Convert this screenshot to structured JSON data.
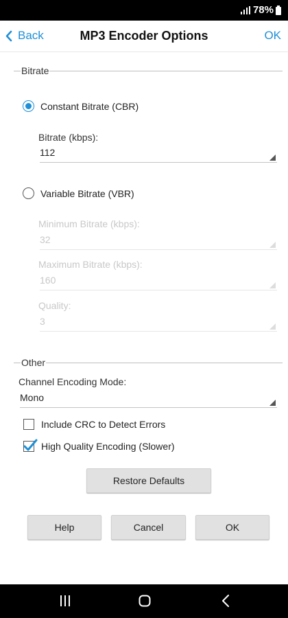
{
  "status_bar": {
    "battery": "78%"
  },
  "header": {
    "back_label": "Back",
    "title": "MP3 Encoder Options",
    "ok_label": "OK"
  },
  "bitrate_section": {
    "title": "Bitrate",
    "cbr_label": "Constant Bitrate (CBR)",
    "cbr_selected": true,
    "bitrate_label": "Bitrate (kbps):",
    "bitrate_value": "112",
    "vbr_label": "Variable Bitrate (VBR)",
    "vbr_selected": false,
    "min_label": "Minimum Bitrate (kbps):",
    "min_value": "32",
    "max_label": "Maximum Bitrate (kbps):",
    "max_value": "160",
    "quality_label": "Quality:",
    "quality_value": "3"
  },
  "other_section": {
    "title": "Other",
    "channel_label": "Channel Encoding Mode:",
    "channel_value": "Mono",
    "crc_label": "Include CRC to Detect Errors",
    "crc_checked": false,
    "hq_label": "High Quality Encoding (Slower)",
    "hq_checked": true
  },
  "buttons": {
    "restore_defaults": "Restore Defaults",
    "help": "Help",
    "cancel": "Cancel",
    "ok": "OK"
  },
  "nav_bar": {
    "recents_icon": "recents-icon",
    "home_icon": "home-icon",
    "back_icon": "back-icon"
  },
  "colors": {
    "accent": "#1f8fd6",
    "disabled_text": "#c8c8c8",
    "button_bg": "#e1e1e1"
  }
}
